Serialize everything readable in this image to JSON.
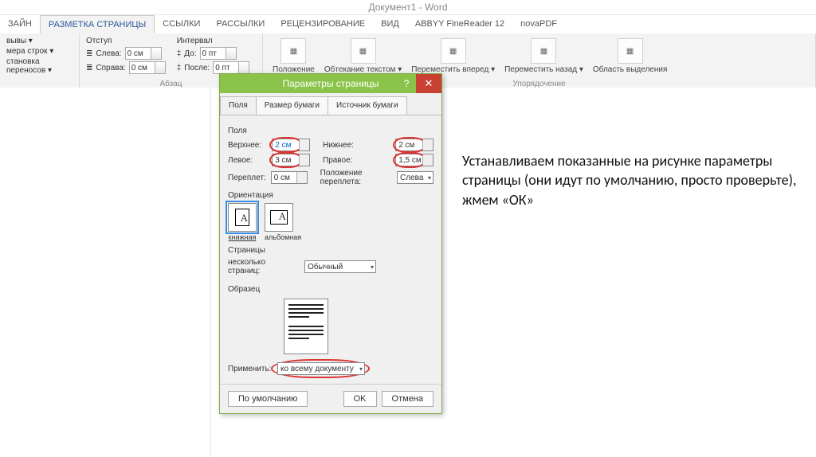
{
  "title": "Документ1 - Word",
  "tabs": [
    "ЗАЙН",
    "РАЗМЕТКА СТРАНИЦЫ",
    "ССЫЛКИ",
    "РАССЫЛКИ",
    "РЕЦЕНЗИРОВАНИЕ",
    "ВИД",
    "ABBYY FineReader 12",
    "novaPDF"
  ],
  "ribbon": {
    "left_items": [
      "вывы ▾",
      "мера строк ▾",
      "становка переносов ▾"
    ],
    "indent_label": "Отступ",
    "indent_left_label": "Слева:",
    "indent_left_value": "0 см",
    "indent_right_label": "Справа:",
    "indent_right_value": "0 см",
    "interval_label": "Интервал",
    "interval_before_label": "До:",
    "interval_before_value": "0 пт",
    "interval_after_label": "После:",
    "interval_after_value": "0 пт",
    "group_para": "Абзац",
    "arrange": [
      "Положение",
      "Обтекание текстом ▾",
      "Переместить вперед ▾",
      "Переместить назад ▾",
      "Область выделения"
    ],
    "group_arrange": "Упорядочение"
  },
  "dialog": {
    "title": "Параметры страницы",
    "tabs": [
      "Поля",
      "Размер бумаги",
      "Источник бумаги"
    ],
    "section_fields": "Поля",
    "top_label": "Верхнее:",
    "top_value": "2 см",
    "bottom_label": "Нижнее:",
    "bottom_value": "2 см",
    "left_label": "Левое:",
    "left_value": "3 см",
    "right_label": "Правое:",
    "right_value": "1,5 см",
    "gutter_label": "Переплет:",
    "gutter_value": "0 см",
    "gutter_pos_label": "Положение переплета:",
    "gutter_pos_value": "Слева",
    "section_orient": "Ориентация",
    "orient_portrait": "книжная",
    "orient_landscape": "альбомная",
    "section_pages": "Страницы",
    "multi_pages_label": "несколько страниц:",
    "multi_pages_value": "Обычный",
    "section_preview": "Образец",
    "apply_label": "Применить:",
    "apply_value": "ко всему документу",
    "btn_default": "По умолчанию",
    "btn_ok": "OK",
    "btn_cancel": "Отмена"
  },
  "instruction": "Устанавливаем показанные на рисунке параметры страницы (они идут по умолчанию, просто проверьте), жмем «ОК»"
}
